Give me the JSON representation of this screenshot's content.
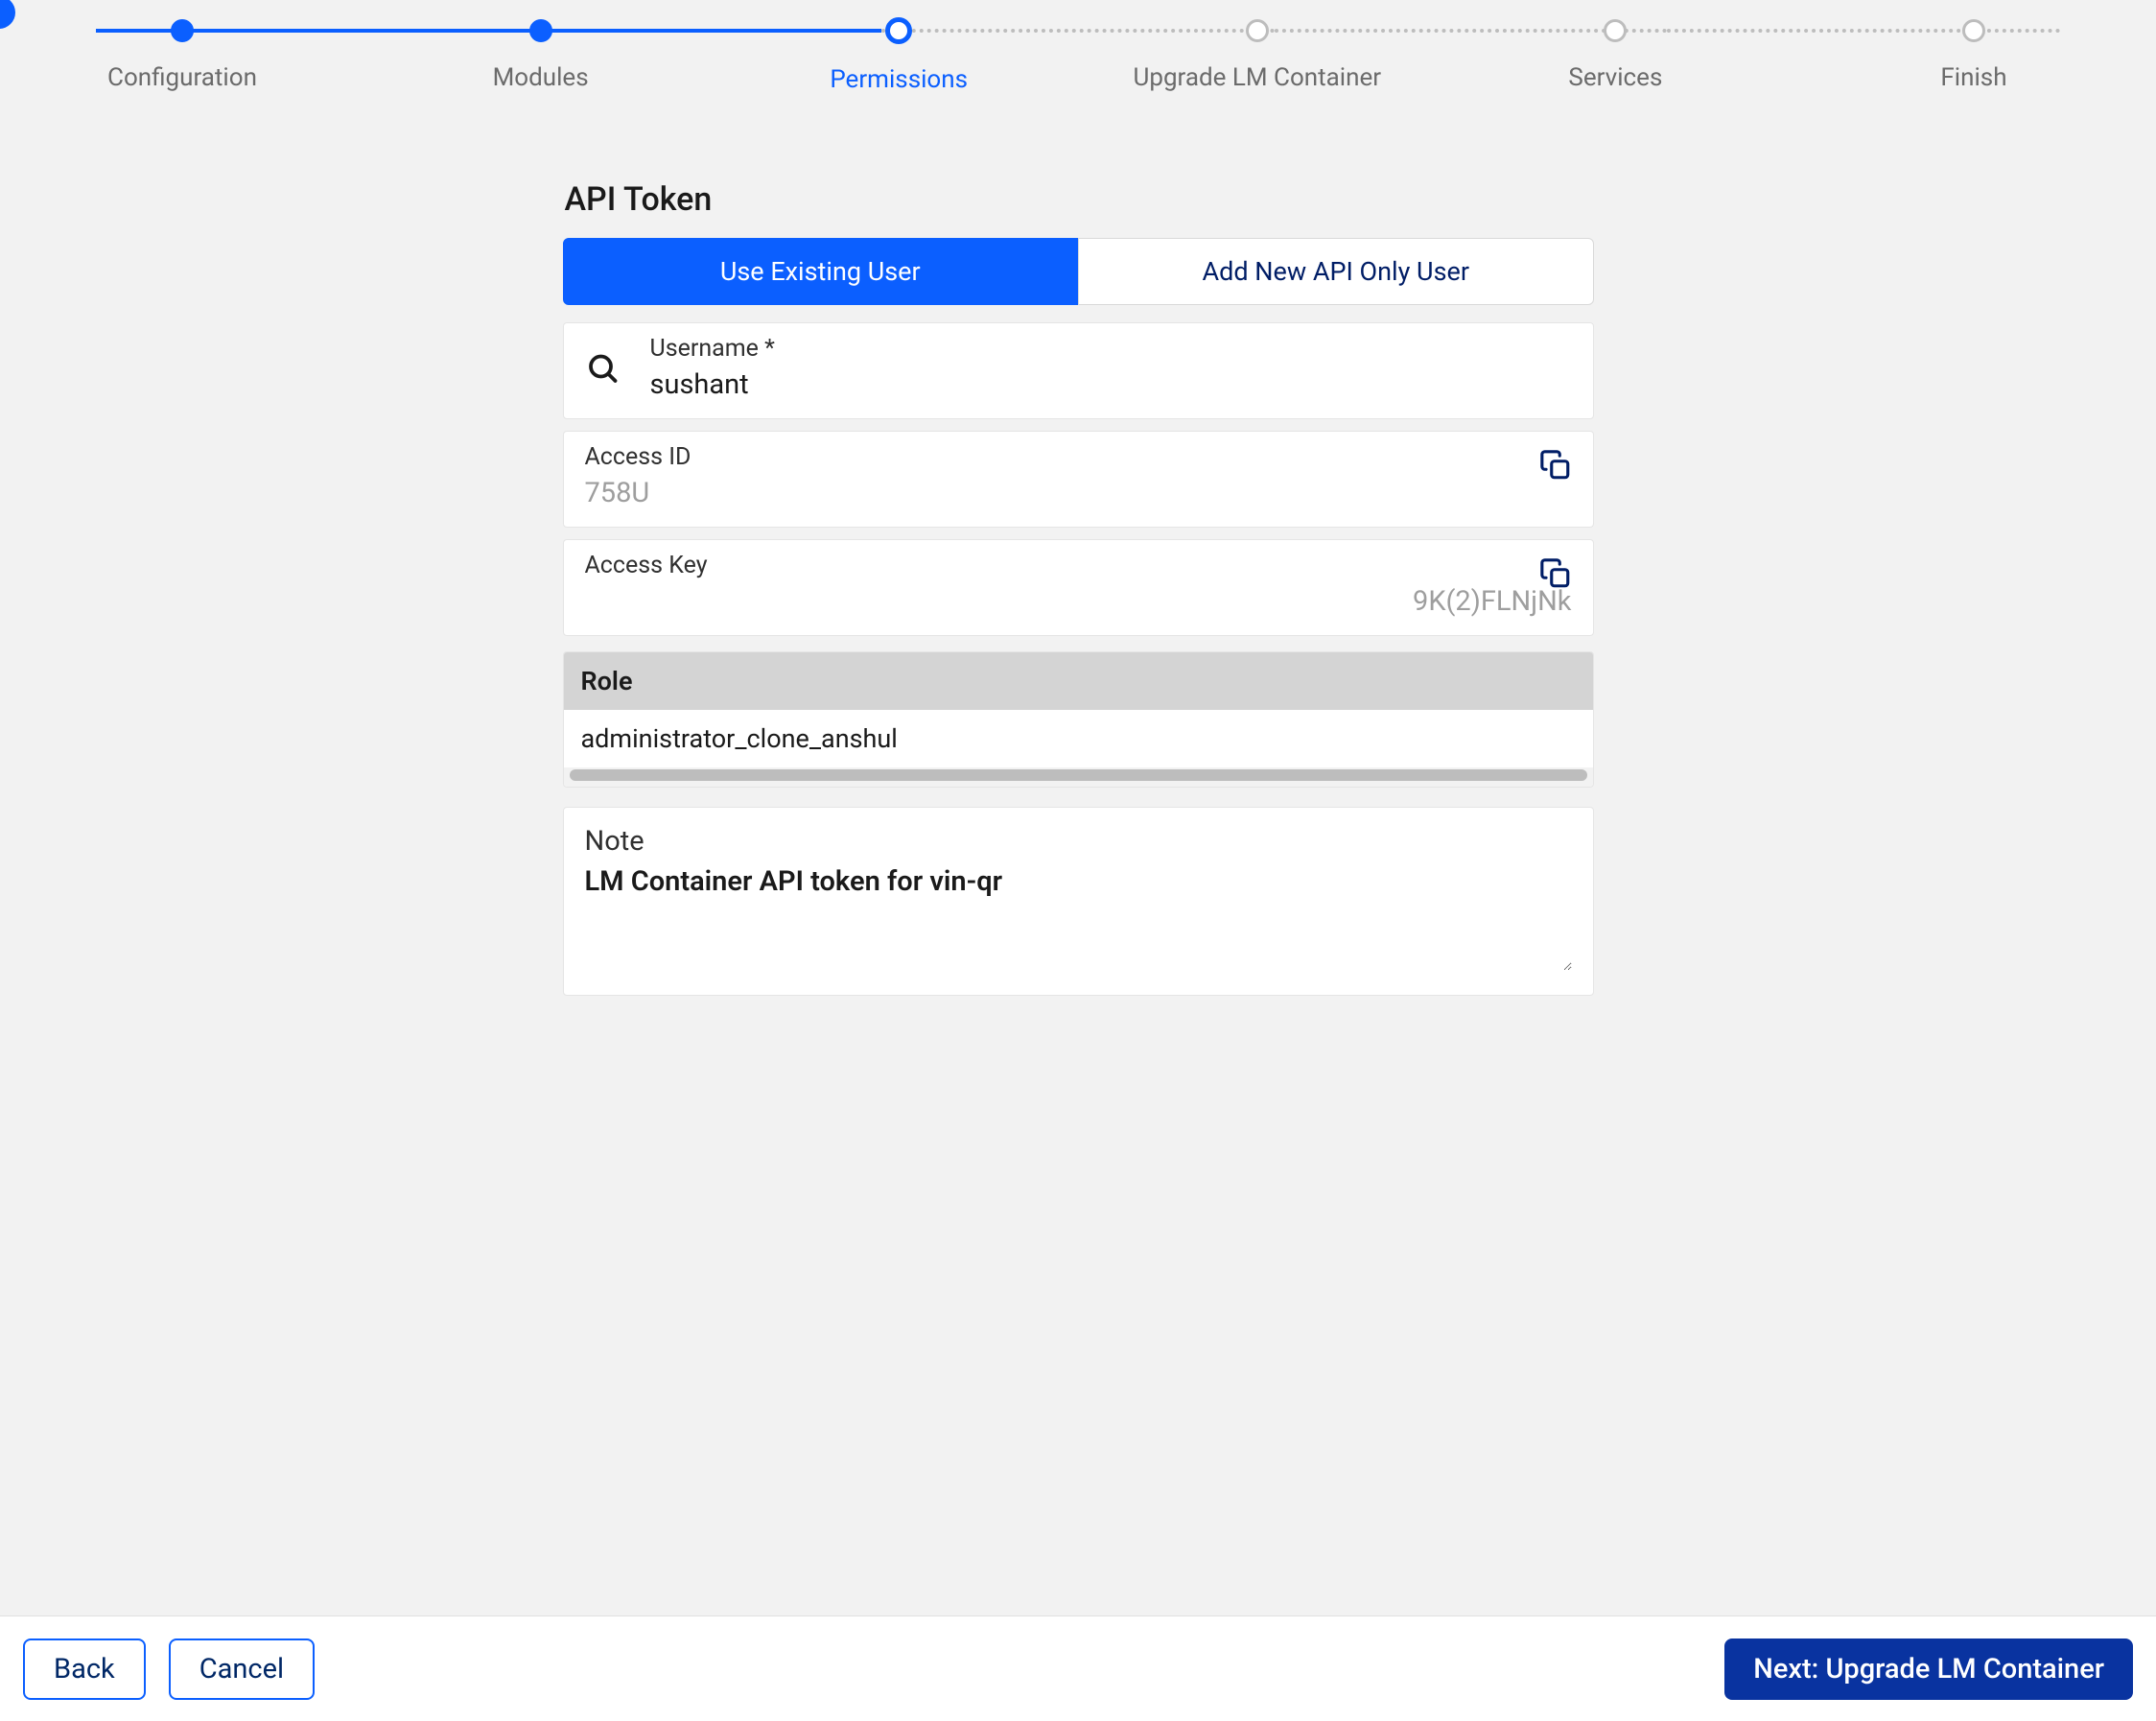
{
  "stepper": {
    "steps": [
      {
        "label": "Configuration",
        "state": "done"
      },
      {
        "label": "Modules",
        "state": "done"
      },
      {
        "label": "Permissions",
        "state": "current"
      },
      {
        "label": "Upgrade LM Container",
        "state": "todo"
      },
      {
        "label": "Services",
        "state": "todo"
      },
      {
        "label": "Finish",
        "state": "todo"
      }
    ]
  },
  "section_title": "API Token",
  "tabs": {
    "existing": "Use Existing User",
    "addnew": "Add New API Only User"
  },
  "fields": {
    "username_label": "Username *",
    "username_value": "sushant",
    "accessid_label": "Access ID",
    "accessid_value": "758U",
    "accesskey_label": "Access Key",
    "accesskey_value": "9K(2)FLNjNk"
  },
  "role": {
    "header": "Role",
    "value": "administrator_clone_anshul"
  },
  "note": {
    "label": "Note",
    "value": "LM Container API token for vin-qr"
  },
  "footer": {
    "back": "Back",
    "cancel": "Cancel",
    "next": "Next: Upgrade LM Container"
  },
  "colors": {
    "primary": "#0b5fff",
    "nav_dark": "#0933a0"
  }
}
